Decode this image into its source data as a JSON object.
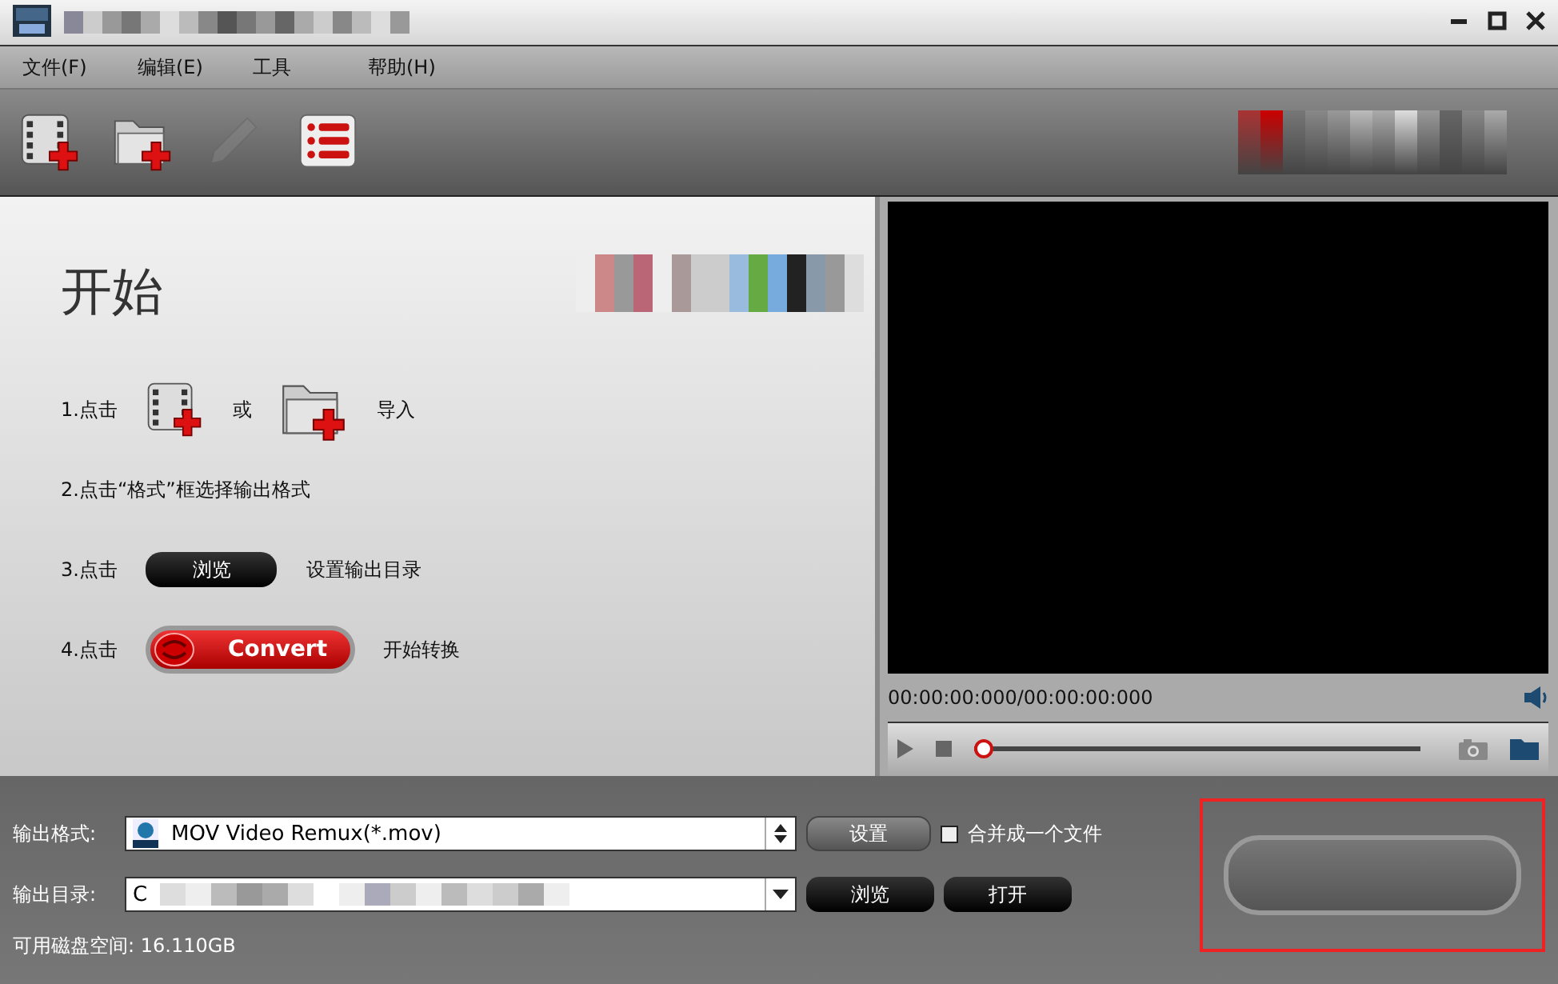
{
  "menu": [
    "文件(F)",
    "编辑(E)",
    "工具",
    "帮助(H)"
  ],
  "toolbar": [
    {
      "kind": "video",
      "disabled": false
    },
    {
      "kind": "folder",
      "disabled": false
    },
    {
      "kind": "edit",
      "disabled": true
    },
    {
      "kind": "list",
      "disabled": false
    }
  ],
  "start": {
    "title": "开始",
    "steps": [
      {
        "kind": "icons",
        "prefix": "1.点击",
        "middle": "或",
        "suffix": "导入"
      },
      {
        "kind": "text",
        "text": "2.点击“格式”框选择输出格式"
      },
      {
        "kind": "browse",
        "prefix": "3.点击",
        "button": "浏览",
        "suffix": "设置输出目录"
      },
      {
        "kind": "convert",
        "prefix": "4.点击",
        "button": "Convert",
        "suffix": "开始转换"
      }
    ]
  },
  "player": {
    "time": "00:00:00:000/00:00:00:000",
    "level": 0
  },
  "output": {
    "format_label": "输出格式:",
    "format_value": "MOV Video Remux(*.mov)",
    "settings_button": "设置",
    "merge": {
      "label": "合并成一个文件",
      "checked": false
    },
    "dir_label": "输出目录:",
    "dir_value": "C",
    "browse_button": "浏览",
    "open_button": "打开",
    "disk_space": "可用磁盘空间: 16.110GB"
  }
}
